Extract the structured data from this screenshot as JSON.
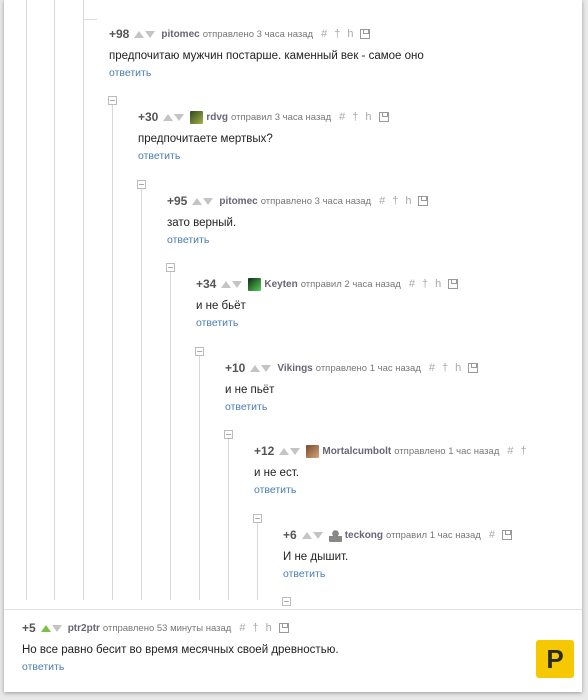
{
  "comments": [
    {
      "score": "+98",
      "author": "pitomec",
      "when": "отправлено 3 часа назад",
      "text": "предпочитаю мужчин постарше. каменный век - самое оно",
      "reply": "ответить",
      "hash": "#",
      "up": "†",
      "down": "h"
    },
    {
      "score": "+30",
      "author": "rdvg",
      "when": "отправил 3 часа назад",
      "text": "предпочитаете мертвых?",
      "reply": "ответить",
      "hash": "#",
      "up": "†",
      "down": "h"
    },
    {
      "score": "+95",
      "author": "pitomec",
      "when": "отправлено 3 часа назад",
      "text": "зато верный.",
      "reply": "ответить",
      "hash": "#",
      "up": "†",
      "down": "h"
    },
    {
      "score": "+34",
      "author": "Keyten",
      "when": "отправил 2 часа назад",
      "text": "и не бьёт",
      "reply": "ответить",
      "hash": "#",
      "up": "†",
      "down": "h"
    },
    {
      "score": "+10",
      "author": "Vikings",
      "when": "отправлено 1 час назад",
      "text": "и не пьёт",
      "reply": "ответить",
      "hash": "#",
      "up": "†",
      "down": "h"
    },
    {
      "score": "+12",
      "author": "Mortalcumbolt",
      "when": "отправлено 1 час назад",
      "text": "и не ест.",
      "reply": "ответить",
      "hash": "#",
      "up": "†",
      "down": "h"
    },
    {
      "score": "+6",
      "author": "teckong",
      "when": "отправил 1 час назад",
      "text": "И не дышит.",
      "reply": "ответить",
      "hash": "#",
      "up": "†",
      "down": "h"
    },
    {
      "score": "+5",
      "author": "ptr2ptr",
      "when": "отправлено 53 минуты назад",
      "text": "Но все равно бесит во время месячных своей древностью.",
      "reply": "ответить",
      "hash": "#",
      "up": "†",
      "down": "h"
    }
  ],
  "logo": "P",
  "colors": {
    "upvote_active": "#7cc142",
    "link": "#4a7cb0"
  }
}
